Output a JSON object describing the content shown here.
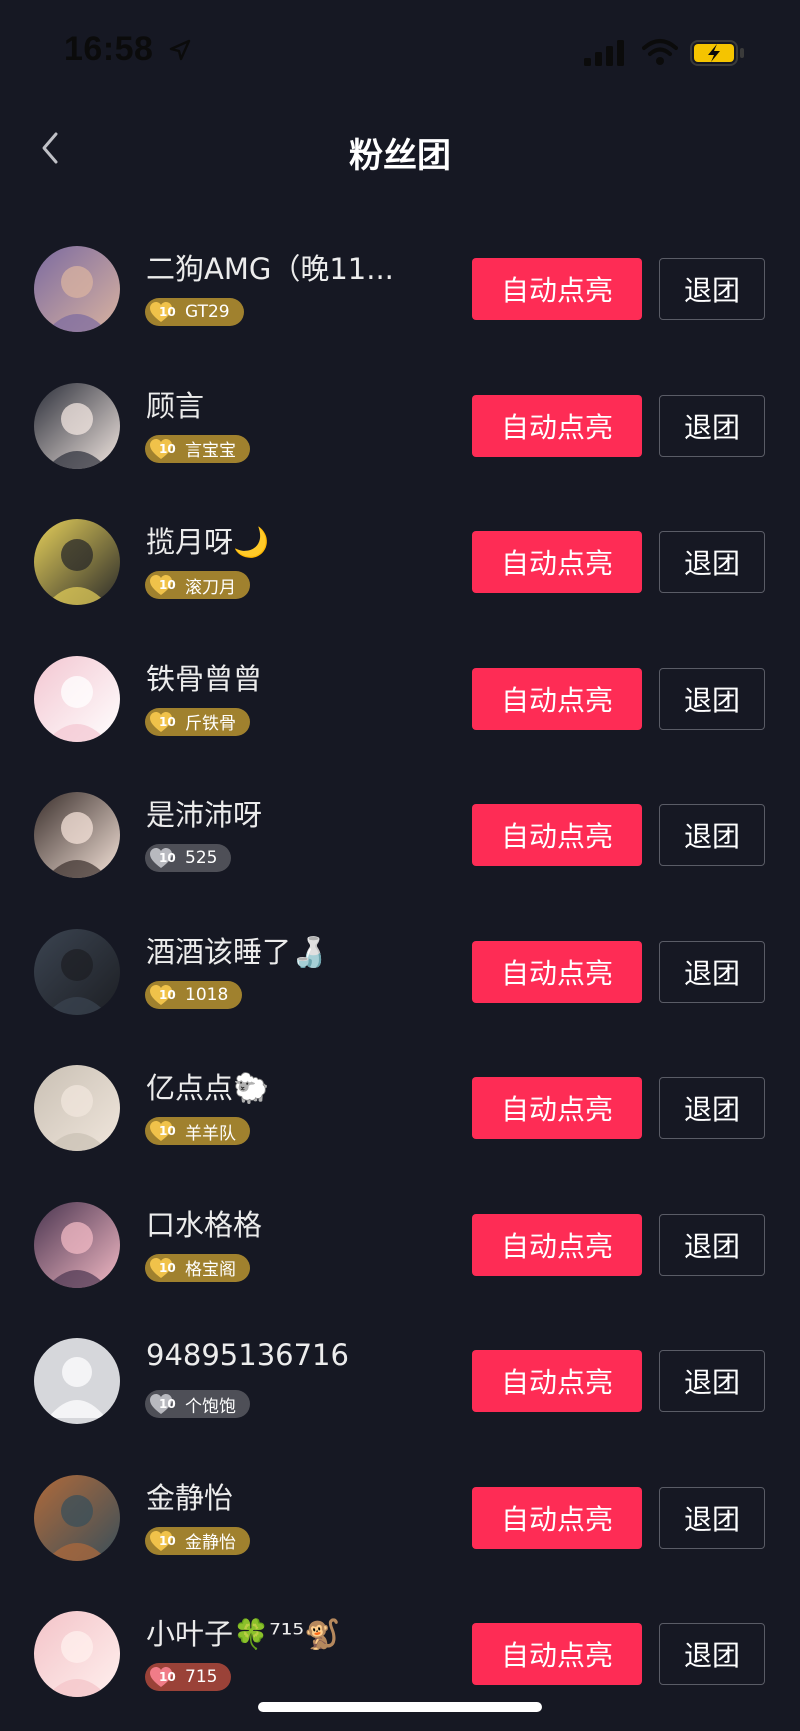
{
  "status_bar": {
    "time": "16:58",
    "location_icon": "location-arrow-icon",
    "signal_icon": "cellular-signal-icon",
    "wifi_icon": "wifi-icon",
    "battery_icon": "battery-charging-icon",
    "battery_color": "#f5c400"
  },
  "header": {
    "title": "粉丝团",
    "back_icon": "chevron-left-icon"
  },
  "colors": {
    "background": "#161823",
    "primary_button": "#fe2c55",
    "badge_gold": "#a0812e",
    "badge_gray": "#4e4f57",
    "badge_red": "#9a4238"
  },
  "fans": [
    {
      "name": "二狗AMG（晚11...",
      "badge": "GT29",
      "badge_level": "10",
      "badge_style": "gold",
      "avatar": "avatar-photo",
      "primary_label": "自动点亮",
      "secondary_label": "退团"
    },
    {
      "name": "顾言",
      "badge": "言宝宝",
      "badge_level": "10",
      "badge_style": "gold",
      "avatar": "avatar-photo",
      "primary_label": "自动点亮",
      "secondary_label": "退团"
    },
    {
      "name": "揽月呀🌙",
      "badge": "滚刀月",
      "badge_level": "10",
      "badge_style": "gold",
      "avatar": "avatar-photo",
      "primary_label": "自动点亮",
      "secondary_label": "退团"
    },
    {
      "name": "铁骨曾曾",
      "badge": "斤铁骨",
      "badge_level": "10",
      "badge_style": "gold",
      "avatar": "avatar-photo",
      "primary_label": "自动点亮",
      "secondary_label": "退团"
    },
    {
      "name": "是沛沛呀",
      "badge": "525",
      "badge_level": "10",
      "badge_style": "gray",
      "avatar": "avatar-photo",
      "primary_label": "自动点亮",
      "secondary_label": "退团"
    },
    {
      "name": "酒酒该睡了🍶",
      "badge": "1018",
      "badge_level": "10",
      "badge_style": "gold",
      "avatar": "avatar-photo",
      "primary_label": "自动点亮",
      "secondary_label": "退团"
    },
    {
      "name": "亿点点🐑",
      "badge": "羊羊队",
      "badge_level": "10",
      "badge_style": "gold",
      "avatar": "avatar-photo",
      "primary_label": "自动点亮",
      "secondary_label": "退团"
    },
    {
      "name": "口水格格",
      "badge": "格宝阁",
      "badge_level": "10",
      "badge_style": "gold",
      "avatar": "avatar-photo",
      "primary_label": "自动点亮",
      "secondary_label": "退团"
    },
    {
      "name": "94895136716",
      "badge": "个饱饱",
      "badge_level": "10",
      "badge_style": "gray",
      "avatar": "default-avatar",
      "primary_label": "自动点亮",
      "secondary_label": "退团"
    },
    {
      "name": "金静怡",
      "badge": "金静怡",
      "badge_level": "10",
      "badge_style": "gold",
      "avatar": "avatar-photo",
      "primary_label": "自动点亮",
      "secondary_label": "退团"
    },
    {
      "name": "小叶子🍀⁷¹⁵🐒",
      "badge": "715",
      "badge_level": "10",
      "badge_style": "red",
      "avatar": "avatar-photo",
      "primary_label": "自动点亮",
      "secondary_label": "退团"
    }
  ]
}
